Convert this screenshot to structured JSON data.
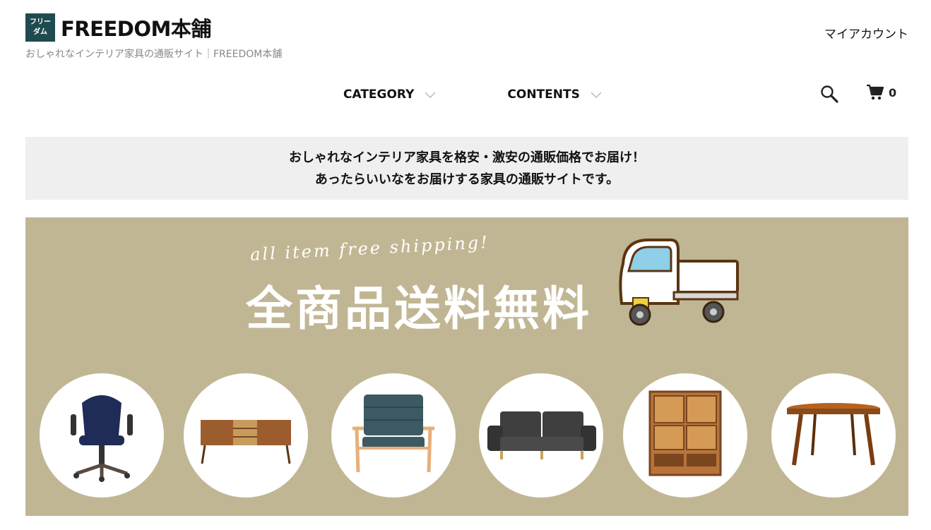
{
  "header": {
    "logo_mark_line1": "フリー",
    "logo_mark_line2": "ダム",
    "logo_text": "FREEDOM本舗",
    "tagline": "おしゃれなインテリア家具の通販サイト｜FREEDOM本舗",
    "account_label": "マイアカウント"
  },
  "nav": {
    "items": [
      {
        "label": "CATEGORY"
      },
      {
        "label": "CONTENTS"
      }
    ]
  },
  "tools": {
    "search_icon": "search-icon",
    "cart_icon": "cart-icon",
    "cart_count": "0"
  },
  "notice": {
    "line1": "おしゃれなインテリア家具を格安・激安の通販価格でお届け！",
    "line2": "あったらいいなをお届けする家具の通販サイトです。"
  },
  "banner": {
    "sub": "all item free shipping!",
    "title": "全商品送料無料",
    "background_color": "#c1b693",
    "items": [
      {
        "icon": "office-chair-icon"
      },
      {
        "icon": "sideboard-icon"
      },
      {
        "icon": "armchair-icon"
      },
      {
        "icon": "sofa-icon"
      },
      {
        "icon": "cabinet-icon"
      },
      {
        "icon": "round-table-icon"
      }
    ]
  }
}
